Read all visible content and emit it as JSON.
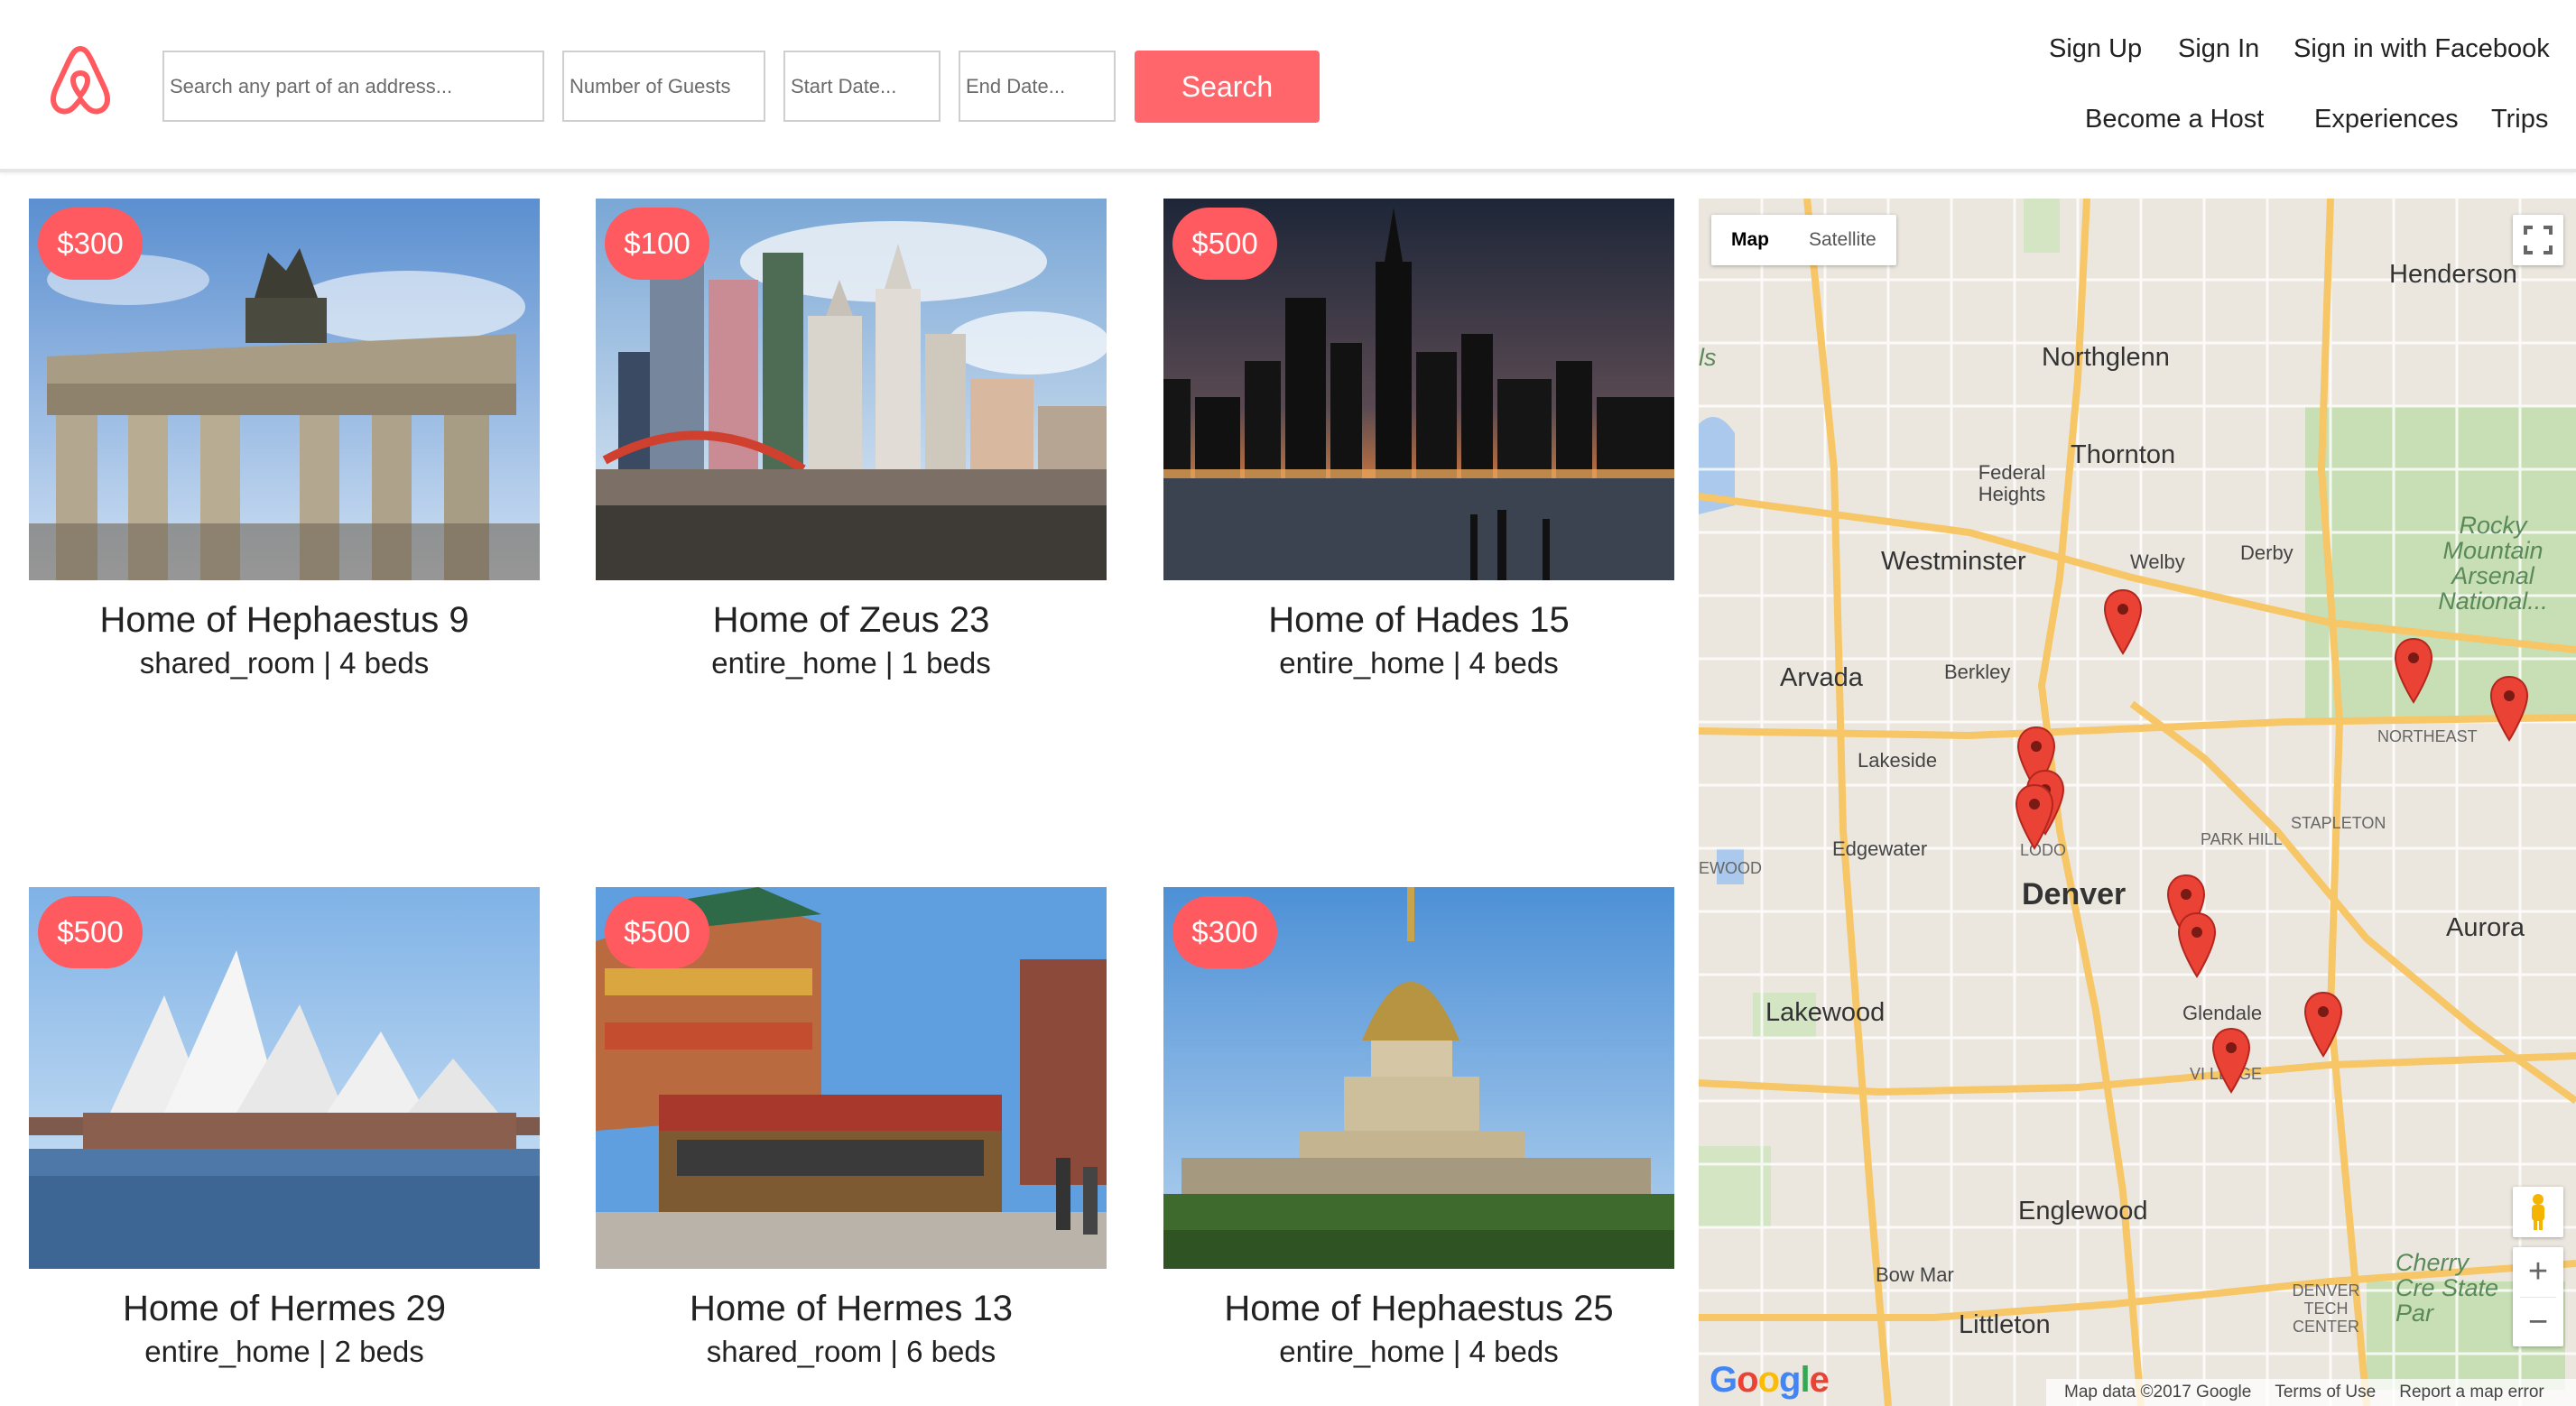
{
  "header": {
    "search_placeholder": "Search any part of an address...",
    "guests_placeholder": "Number of Guests",
    "start_placeholder": "Start Date...",
    "end_placeholder": "End Date...",
    "search_label": "Search",
    "nav": {
      "sign_up": "Sign Up",
      "sign_in": "Sign In",
      "sign_in_facebook": "Sign in with Facebook",
      "become_host": "Become a Host",
      "experiences": "Experiences",
      "trips": "Trips"
    }
  },
  "listings": [
    {
      "price": "$300",
      "title": "Home of Hephaestus 9",
      "meta": "shared_room | 4 beds",
      "photo": "brandenburg-gate"
    },
    {
      "price": "$100",
      "title": "Home of Zeus 23",
      "meta": "entire_home | 1 beds",
      "photo": "las-vegas-skyline"
    },
    {
      "price": "$500",
      "title": "Home of Hades 15",
      "meta": "entire_home | 4 beds",
      "photo": "new-york-night-skyline"
    },
    {
      "price": "$500",
      "title": "Home of Hermes 29",
      "meta": "entire_home | 2 beds",
      "photo": "sydney-opera-house"
    },
    {
      "price": "$500",
      "title": "Home of Hermes 13",
      "meta": "shared_room | 6 beds",
      "photo": "chinatown-cable-car"
    },
    {
      "price": "$300",
      "title": "Home of Hephaestus 25",
      "meta": "entire_home | 4 beds",
      "photo": "les-invalides-dome"
    }
  ],
  "map": {
    "type_options": [
      "Map",
      "Satellite"
    ],
    "active_type": "Map",
    "places": {
      "henderson": "Henderson",
      "northglenn": "Northglenn",
      "thornton": "Thornton",
      "federal_heights": "Federal Heights",
      "westminster": "Westminster",
      "welby": "Welby",
      "derby": "Derby",
      "arvada": "Arvada",
      "berkley": "Berkley",
      "lakeside": "Lakeside",
      "edgewater": "Edgewater",
      "denver": "Denver",
      "lodo": "LODO",
      "park_hill": "PARK HILL",
      "stapleton": "STAPLETON",
      "northeast": "NORTHEAST",
      "aurora": "Aurora",
      "lakewood": "Lakewood",
      "glendale": "Glendale",
      "englewood": "Englewood",
      "bow_mar": "Bow Mar",
      "littleton": "Littleton",
      "rocky_mountain": "Rocky Mountain Arsenal National...",
      "cherry_creek": "Cherry Cre State Par",
      "denver_tech": "DENVER TECH CENTER",
      "lewood": "EWOOD",
      "ls": "ls",
      "village": "VI  LLAGE"
    },
    "footer": {
      "data": "Map data ©2017 Google",
      "terms": "Terms of Use",
      "report": "Report a map error"
    },
    "google": "Google",
    "zoom_in": "+",
    "zoom_out": "−"
  },
  "colors": {
    "brand": "#ff5a5f",
    "marker": "#ea4335"
  }
}
